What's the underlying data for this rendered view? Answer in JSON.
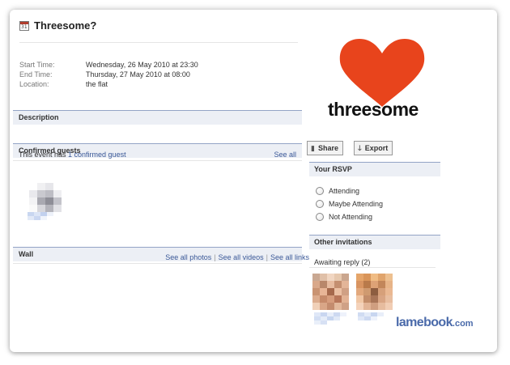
{
  "event": {
    "title": "Threesome?",
    "calendar_day": "31",
    "fields": [
      {
        "label": "Start Time:",
        "value": "Wednesday, 26 May 2010 at 23:30"
      },
      {
        "label": "End Time:",
        "value": "Thursday, 27 May 2010 at 08:00"
      },
      {
        "label": "Location:",
        "value": "the flat"
      }
    ]
  },
  "description": {
    "header": "Description"
  },
  "guests": {
    "header": "Confirmed guests",
    "summary_prefix": "This event has ",
    "summary_link": "1 confirmed guest",
    "see_all": "See all"
  },
  "wall": {
    "header": "Wall",
    "links": [
      "See all photos",
      "See all videos",
      "See all links"
    ],
    "separator": "|"
  },
  "logo": {
    "word": "threesome",
    "heart_color": "#e8441c"
  },
  "actions": {
    "share": "Share",
    "export": "Export"
  },
  "rsvp": {
    "header": "Your RSVP",
    "options": [
      "Attending",
      "Maybe Attending",
      "Not Attending"
    ]
  },
  "invitations": {
    "header": "Other invitations",
    "awaiting": "Awaiting reply (2)"
  },
  "watermark": {
    "brand": "lamebook",
    "tld": ".com"
  },
  "colors": {
    "link": "#3b5998",
    "section_bg": "#eceff5",
    "section_border": "#93a4c6"
  }
}
